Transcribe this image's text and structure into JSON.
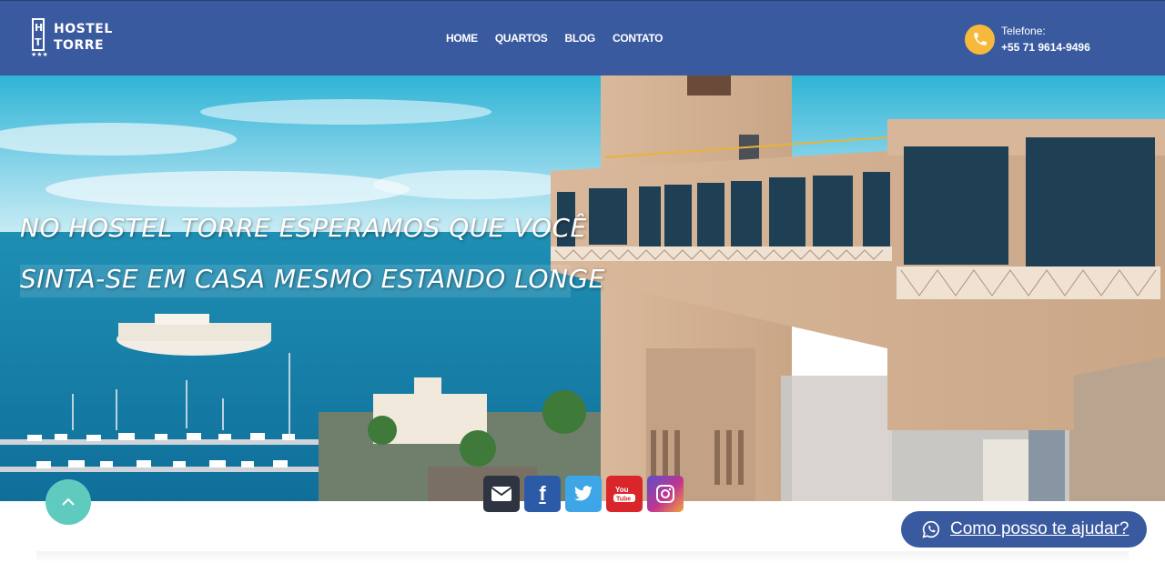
{
  "header": {
    "logo": {
      "line1": "HOSTEL",
      "line2": "TORRE",
      "mark": "HT",
      "icon": "hostel-logo-icon"
    },
    "nav": [
      {
        "label": "HOME"
      },
      {
        "label": "QUARTOS"
      },
      {
        "label": "BLOG"
      },
      {
        "label": "CONTATO"
      }
    ],
    "phone": {
      "icon": "phone-icon",
      "label": "Telefone:",
      "number": "+55 71 9614-9496"
    }
  },
  "hero": {
    "line1": "NO HOSTEL TORRE ESPERAMOS QUE VOCÊ",
    "line2": "SINTA-SE EM CASA MESMO ESTANDO LONGE"
  },
  "social": [
    {
      "name": "mail-icon",
      "glyph": "✉"
    },
    {
      "name": "facebook-icon",
      "glyph": "f"
    },
    {
      "name": "twitter-icon",
      "glyph": "t"
    },
    {
      "name": "youtube-icon",
      "glyph": "You Tube"
    },
    {
      "name": "instagram-icon",
      "glyph": "◎"
    }
  ],
  "back_to_top": {
    "icon": "chevron-up-icon"
  },
  "chat": {
    "icon": "whatsapp-icon",
    "label": "Como posso te ajudar?"
  },
  "colors": {
    "primary": "#3a5aa0",
    "accent": "#f6b93b",
    "teal": "#5fcbbf"
  }
}
